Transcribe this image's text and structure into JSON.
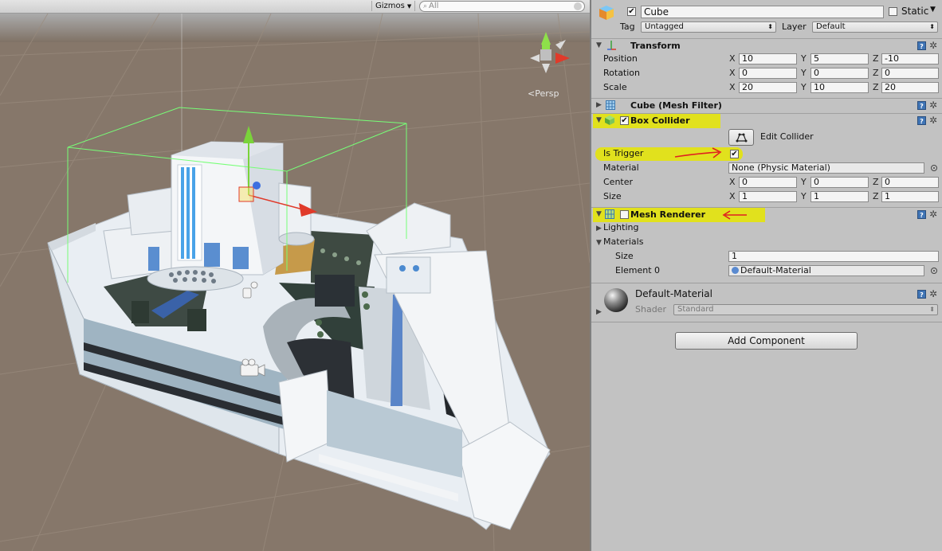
{
  "scene": {
    "gizmos_label": "Gizmos",
    "search_placeholder": "All",
    "projection_label": "Persp",
    "axis_labels": {
      "y": "y",
      "z": "z",
      "x": "x"
    }
  },
  "inspector": {
    "object": {
      "name": "Cube",
      "active": true,
      "static_label": "Static",
      "static": false,
      "tag_label": "Tag",
      "tag_value": "Untagged",
      "layer_label": "Layer",
      "layer_value": "Default"
    },
    "transform": {
      "title": "Transform",
      "position_label": "Position",
      "rotation_label": "Rotation",
      "scale_label": "Scale",
      "axis_x": "X",
      "axis_y": "Y",
      "axis_z": "Z",
      "position": {
        "x": "10",
        "y": "5",
        "z": "-10"
      },
      "rotation": {
        "x": "0",
        "y": "0",
        "z": "0"
      },
      "scale": {
        "x": "20",
        "y": "10",
        "z": "20"
      }
    },
    "mesh_filter": {
      "title": "Cube (Mesh Filter)"
    },
    "box_collider": {
      "title": "Box Collider",
      "enabled": true,
      "edit_collider_label": "Edit Collider",
      "is_trigger_label": "Is Trigger",
      "is_trigger": true,
      "material_label": "Material",
      "material_value": "None (Physic Material)",
      "center_label": "Center",
      "center": {
        "x": "0",
        "y": "0",
        "z": "0"
      },
      "size_label": "Size",
      "size": {
        "x": "1",
        "y": "1",
        "z": "1"
      }
    },
    "mesh_renderer": {
      "title": "Mesh Renderer",
      "enabled": false,
      "lighting_label": "Lighting",
      "materials_label": "Materials",
      "size_label": "Size",
      "size_value": "1",
      "element0_label": "Element 0",
      "element0_value": "Default-Material"
    },
    "material": {
      "name": "Default-Material",
      "shader_label": "Shader",
      "shader_value": "Standard"
    },
    "add_component_label": "Add Component"
  },
  "colors": {
    "inspector_bg": "#c2c2c2",
    "highlight": "#e6e600",
    "annotation_red": "#e02020",
    "ground": "#8a7a6a",
    "collider_green": "#77ff77"
  }
}
